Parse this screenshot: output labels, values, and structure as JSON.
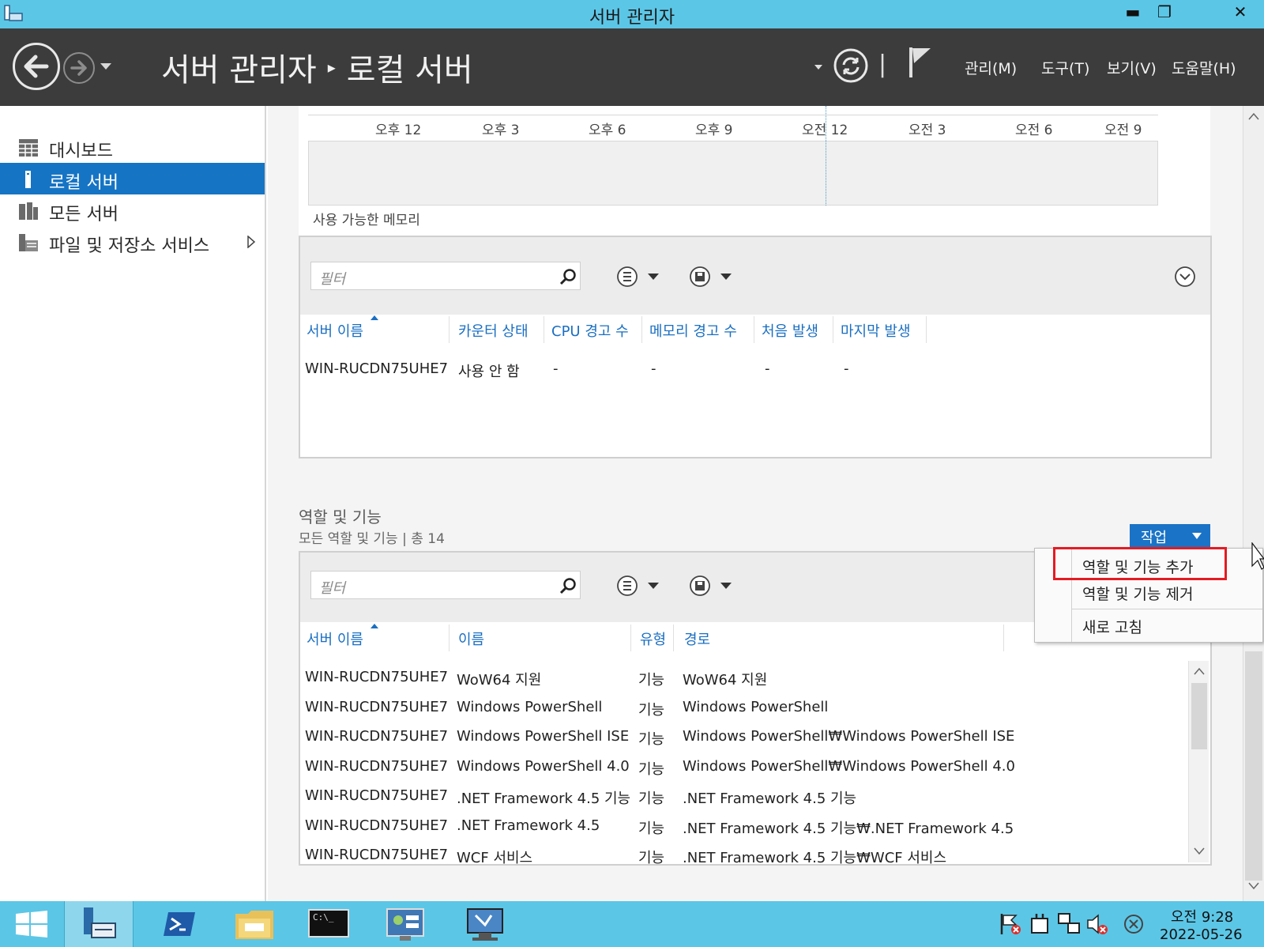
{
  "window": {
    "title": "서버 관리자",
    "minimize": "▬",
    "restore": "❐",
    "close": "✕"
  },
  "header": {
    "breadcrumb_root": "서버 관리자",
    "breadcrumb_sep": "▸",
    "breadcrumb_current": "로컬 서버",
    "divider": "|",
    "menus": [
      "관리(M)",
      "도구(T)",
      "보기(V)",
      "도움말(H)"
    ]
  },
  "sidebar": {
    "items": [
      {
        "label": "대시보드",
        "icon": "dashboard-icon"
      },
      {
        "label": "로컬 서버",
        "icon": "local-server-icon",
        "active": true
      },
      {
        "label": "모든 서버",
        "icon": "all-servers-icon"
      },
      {
        "label": "파일 및 저장소 서비스",
        "icon": "file-storage-icon",
        "has_submenu": true
      }
    ]
  },
  "performance": {
    "time_ticks": [
      "오후 12",
      "오후 3",
      "오후 6",
      "오후 9",
      "오전 12",
      "오전 3",
      "오전 6",
      "오전 9"
    ],
    "memory_label": "사용 가능한 메모리",
    "filter_placeholder": "필터",
    "columns": [
      "서버 이름",
      "카운터 상태",
      "CPU 경고 수",
      "메모리 경고 수",
      "처음 발생",
      "마지막 발생"
    ],
    "rows": [
      [
        "WIN-RUCDN75UHE7",
        "사용 안 함",
        "-",
        "-",
        "-",
        "-"
      ]
    ]
  },
  "roles": {
    "title": "역할 및 기능",
    "subtitle": "모든 역할 및 기능 | 총 14",
    "tasks_label": "작업",
    "tasks_menu": [
      "역할 및 기능 추가",
      "역할 및 기능 제거",
      "새로 고침"
    ],
    "filter_placeholder": "필터",
    "columns": [
      "서버 이름",
      "이름",
      "유형",
      "경로"
    ],
    "rows": [
      [
        "WIN-RUCDN75UHE7",
        "WoW64 지원",
        "기능",
        "WoW64 지원"
      ],
      [
        "WIN-RUCDN75UHE7",
        "Windows PowerShell",
        "기능",
        "Windows PowerShell"
      ],
      [
        "WIN-RUCDN75UHE7",
        "Windows PowerShell ISE",
        "기능",
        "Windows PowerShell₩Windows PowerShell ISE"
      ],
      [
        "WIN-RUCDN75UHE7",
        "Windows PowerShell 4.0",
        "기능",
        "Windows PowerShell₩Windows PowerShell 4.0"
      ],
      [
        "WIN-RUCDN75UHE7",
        ".NET Framework 4.5 기능",
        "기능",
        ".NET Framework 4.5 기능"
      ],
      [
        "WIN-RUCDN75UHE7",
        ".NET Framework 4.5",
        "기능",
        ".NET Framework 4.5 기능₩.NET Framework 4.5"
      ],
      [
        "WIN-RUCDN75UHE7",
        "WCF 서비스",
        "기능",
        ".NET Framework 4.5 기능₩WCF 서비스"
      ]
    ]
  },
  "taskbar": {
    "apps": [
      "start-icon",
      "server-manager-icon",
      "powershell-icon",
      "file-explorer-icon",
      "command-prompt-icon",
      "control-panel-icon",
      "remote-desktop-icon"
    ],
    "cmd_label": "C:\\_",
    "clock_time": "오전 9:28",
    "clock_date": "2022-05-26"
  },
  "colors": {
    "accent": "#1674c4",
    "titlebar": "#5cc6e6",
    "header": "#3c3c3c",
    "highlight": "#e31b23"
  }
}
